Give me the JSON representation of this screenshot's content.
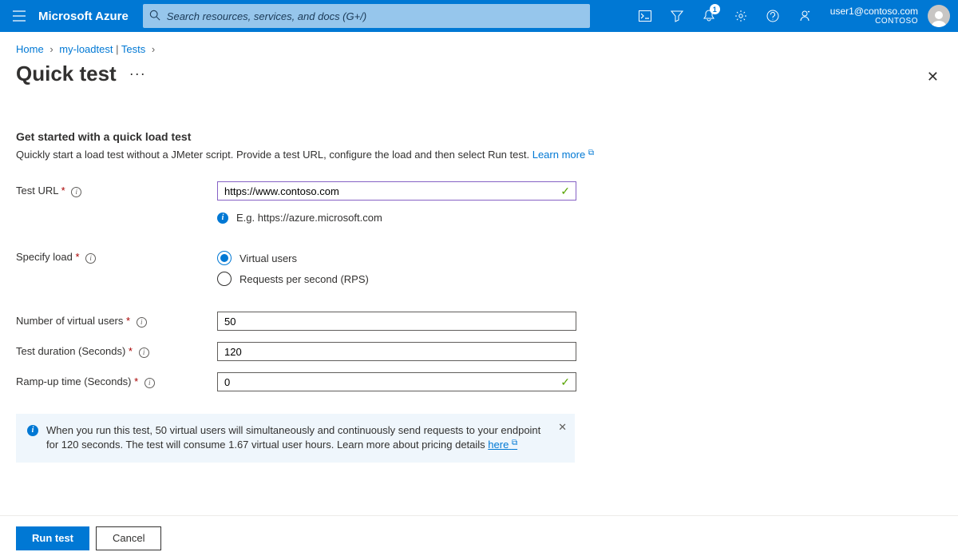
{
  "brand": "Microsoft Azure",
  "search": {
    "placeholder": "Search resources, services, and docs (G+/)"
  },
  "notifications": {
    "count": "1"
  },
  "user": {
    "email": "user1@contoso.com",
    "tenant": "CONTOSO"
  },
  "breadcrumb": {
    "home": "Home",
    "resource": "my-loadtest",
    "sep_pipe": "|",
    "sub": "Tests"
  },
  "page": {
    "title": "Quick test"
  },
  "intro": {
    "heading": "Get started with a quick load test",
    "body": "Quickly start a load test without a JMeter script. Provide a test URL, configure the load and then select Run test. ",
    "learn_more": "Learn more"
  },
  "form": {
    "test_url_label": "Test URL",
    "test_url_value": "https://www.contoso.com",
    "test_url_hint": "E.g. https://azure.microsoft.com",
    "specify_load_label": "Specify load",
    "radio_vu": "Virtual users",
    "radio_rps": "Requests per second (RPS)",
    "num_vu_label": "Number of virtual users",
    "num_vu_value": "50",
    "duration_label": "Test duration (Seconds)",
    "duration_value": "120",
    "rampup_label": "Ramp-up time (Seconds)",
    "rampup_value": "0"
  },
  "banner": {
    "text_a": "When you run this test, 50 virtual users will simultaneously and continuously send requests to your endpoint for 120 seconds. The test will consume 1.67 virtual user hours. Learn more about pricing details ",
    "link": "here"
  },
  "footer": {
    "run": "Run test",
    "cancel": "Cancel"
  }
}
